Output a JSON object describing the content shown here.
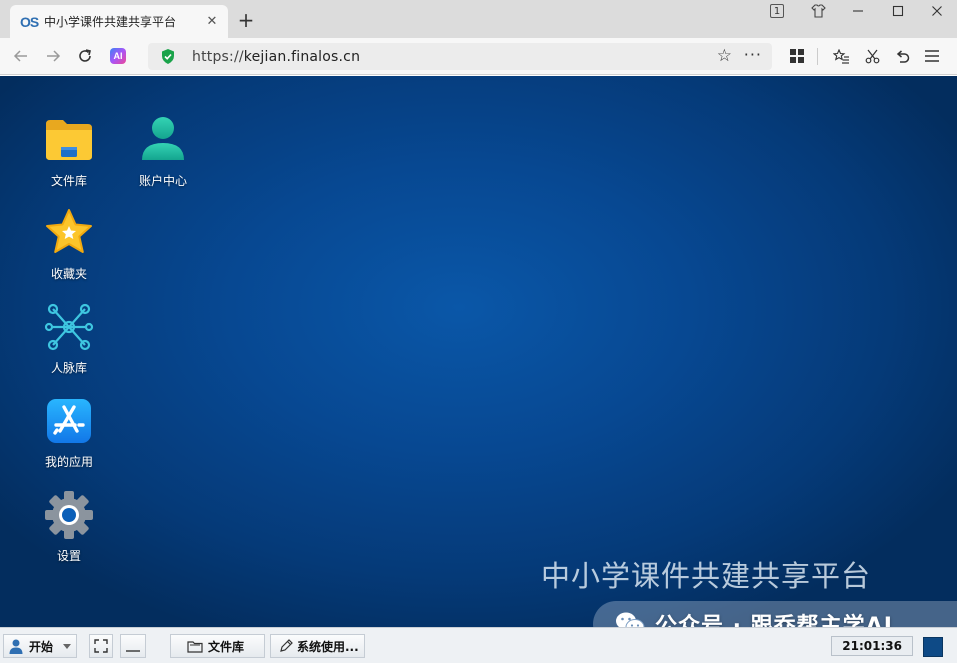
{
  "browser": {
    "tab": {
      "logo": "OS",
      "title": "中小学课件共建共享平台",
      "close": "✕"
    },
    "new_tab": "+",
    "window_badge": "1",
    "toolbar": {
      "ai_label": "AI"
    },
    "address": {
      "scheme": "https://",
      "host": "kejian.finalos.cn"
    }
  },
  "desktop": {
    "icons": [
      {
        "label": "文件库",
        "icon": "folder-icon"
      },
      {
        "label": "账户中心",
        "icon": "user-icon"
      },
      {
        "label": "收藏夹",
        "icon": "star-icon"
      },
      {
        "label": "人脉库",
        "icon": "network-icon"
      },
      {
        "label": "我的应用",
        "icon": "app-store-icon"
      },
      {
        "label": "设置",
        "icon": "gear-icon"
      }
    ],
    "brand_text": "中小学课件共建共享平台",
    "watermark": "公众号 · 跟乔帮主学AI"
  },
  "taskbar": {
    "start_label": "开始",
    "tasks": [
      {
        "label": "文件库",
        "icon": "folder-outline-icon"
      },
      {
        "label": "系统使用...",
        "icon": "pen-icon"
      }
    ],
    "clock": "21:01:36"
  },
  "colors": {
    "desktop_center": "#0a57a8",
    "desktop_edge": "#032d5e",
    "accent": "#2f6fb2"
  }
}
